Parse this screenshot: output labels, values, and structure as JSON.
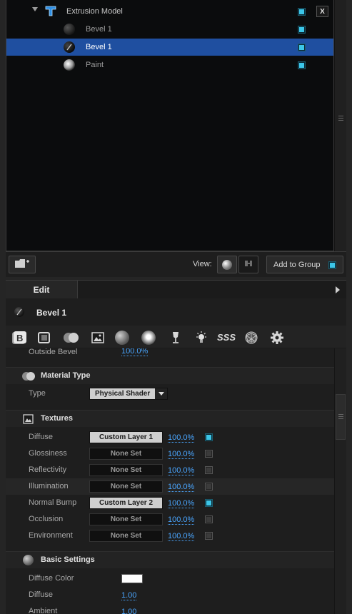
{
  "tree": {
    "rows": [
      {
        "label": "Extrusion Model",
        "checked": true,
        "expanded": true
      },
      {
        "label": "Bevel 1",
        "checked": true
      },
      {
        "label": "Bevel 1",
        "checked": true,
        "selected": true
      },
      {
        "label": "Paint",
        "checked": true
      }
    ],
    "close_label": "X"
  },
  "toolbar": {
    "view_label": "View:",
    "add_group_label": "Add to Group"
  },
  "edit": {
    "tab_label": "Edit",
    "material_name": "Bevel 1",
    "toolbar_icons": [
      "bevel-icon",
      "extrusion-icon",
      "material-type-icon",
      "texture-icon",
      "basic-settings-icon",
      "reflection-icon",
      "glass-icon",
      "light-icon",
      "sss-icon",
      "wireframe-icon",
      "gear-icon"
    ],
    "sss_text": "SSS"
  },
  "props": {
    "outside_bevel": {
      "label": "Outside Bevel",
      "value": "100.0%"
    },
    "material_type": {
      "title": "Material Type",
      "type_label": "Type",
      "type_value": "Physical Shader"
    },
    "textures": {
      "title": "Textures",
      "rows": [
        {
          "label": "Diffuse",
          "slot": "Custom Layer 1",
          "pct": "100.0%",
          "enabled": true
        },
        {
          "label": "Glossiness",
          "slot": "None Set",
          "pct": "100.0%",
          "enabled": false
        },
        {
          "label": "Reflectivity",
          "slot": "None Set",
          "pct": "100.0%",
          "enabled": false
        },
        {
          "label": "Illumination",
          "slot": "None Set",
          "pct": "100.0%",
          "enabled": false
        },
        {
          "label": "Normal Bump",
          "slot": "Custom Layer 2",
          "pct": "100.0%",
          "enabled": true
        },
        {
          "label": "Occlusion",
          "slot": "None Set",
          "pct": "100.0%",
          "enabled": false
        },
        {
          "label": "Environment",
          "slot": "None Set",
          "pct": "100.0%",
          "enabled": false
        }
      ]
    },
    "basic": {
      "title": "Basic Settings",
      "diffuse_color_label": "Diffuse Color",
      "diffuse_color": "#ffffff",
      "diffuse_label": "Diffuse",
      "diffuse_value": "1.00",
      "ambient_label": "Ambient",
      "ambient_value": "1.00"
    }
  },
  "colors": {
    "selection": "#1f4fa0",
    "check_on": "#3cc6e8",
    "link": "#4aa6ff"
  }
}
